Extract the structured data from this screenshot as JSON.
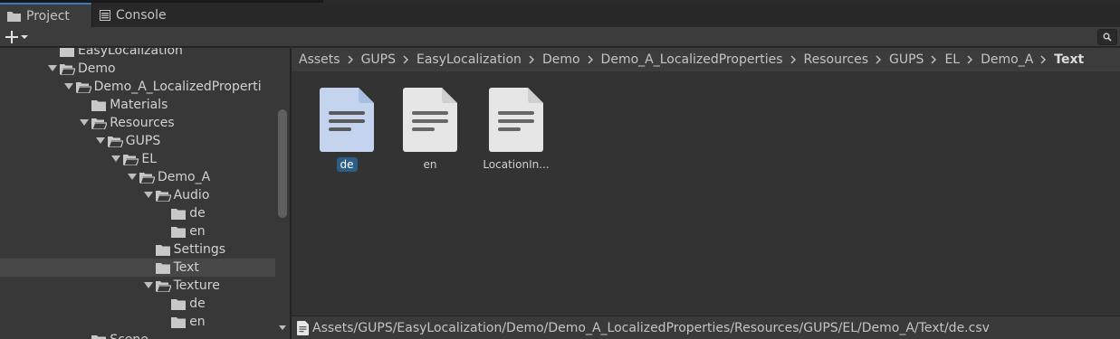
{
  "tabs": [
    {
      "label": "Project",
      "icon": "folder-icon",
      "active": true
    },
    {
      "label": "Console",
      "icon": "console-icon",
      "active": false
    }
  ],
  "toolbar": {
    "add_label": "+"
  },
  "tree": [
    {
      "label": "EasyLocalization",
      "depth": 3,
      "expanded": null
    },
    {
      "label": "Demo",
      "depth": 3,
      "expanded": true
    },
    {
      "label": "Demo_A_LocalizedProperti",
      "depth": 4,
      "expanded": true
    },
    {
      "label": "Materials",
      "depth": 5,
      "expanded": null
    },
    {
      "label": "Resources",
      "depth": 5,
      "expanded": true
    },
    {
      "label": "GUPS",
      "depth": 6,
      "expanded": true
    },
    {
      "label": "EL",
      "depth": 7,
      "expanded": true
    },
    {
      "label": "Demo_A",
      "depth": 8,
      "expanded": true
    },
    {
      "label": "Audio",
      "depth": 9,
      "expanded": true
    },
    {
      "label": "de",
      "depth": 10,
      "expanded": null
    },
    {
      "label": "en",
      "depth": 10,
      "expanded": null
    },
    {
      "label": "Settings",
      "depth": 9,
      "expanded": null
    },
    {
      "label": "Text",
      "depth": 9,
      "expanded": null,
      "selected": true
    },
    {
      "label": "Texture",
      "depth": 9,
      "expanded": true
    },
    {
      "label": "de",
      "depth": 10,
      "expanded": null
    },
    {
      "label": "en",
      "depth": 10,
      "expanded": null
    },
    {
      "label": "Scene",
      "depth": 5,
      "expanded": null
    }
  ],
  "breadcrumb": [
    "Assets",
    "GUPS",
    "EasyLocalization",
    "Demo",
    "Demo_A_LocalizedProperties",
    "Resources",
    "GUPS",
    "EL",
    "Demo_A",
    "Text"
  ],
  "assets": [
    {
      "name": "de",
      "selected": true
    },
    {
      "name": "en",
      "selected": false
    },
    {
      "name": "LocationIn...",
      "selected": false
    }
  ],
  "status": {
    "path": "Assets/GUPS/EasyLocalization/Demo/Demo_A_LocalizedProperties/Resources/GUPS/EL/Demo_A/Text/de.csv"
  },
  "colors": {
    "accent": "#3a79bb",
    "selection": "#2c5d87",
    "doc_selected": "#c4d4ee",
    "doc": "#e6e6e6"
  }
}
